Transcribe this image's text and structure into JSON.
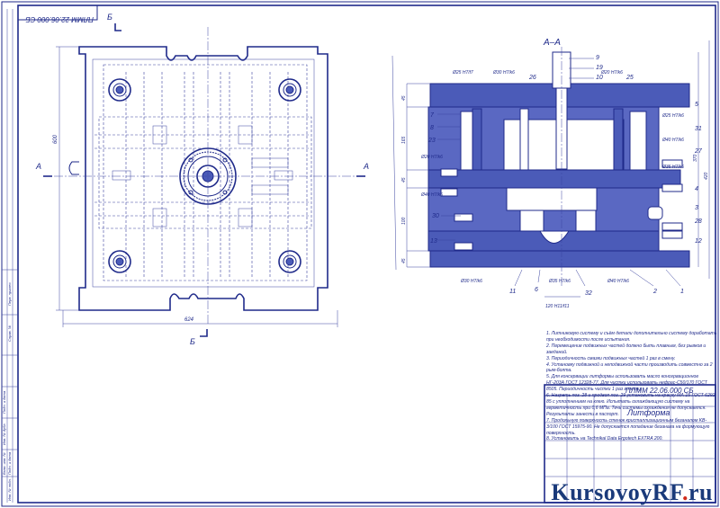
{
  "stamp_code_top": "ПЛММ 22.06.000 СБ",
  "stamp_code_bottom": "ПЛММ 22.06.000 СБ",
  "title_block_name": "Литформа",
  "section_label": "А–А",
  "cut_marks": {
    "a_left": "А",
    "a_right": "А",
    "b_top": "Б",
    "b_bottom": "Б"
  },
  "plan_dims": {
    "height": "600",
    "width": "624"
  },
  "section_dims_left": [
    "45",
    "165",
    "45",
    "100",
    "45"
  ],
  "section_dims_right": [
    "370",
    "420"
  ],
  "fits": [
    "Ø25 H7/f7",
    "Ø30 H7/k6",
    "Ø20 H7/k6",
    "Ø25 H7/k6",
    "Ø40 H7/k6",
    "Ø20 H7/k6",
    "Ø35 H7/k6",
    "Ø40 H7/k6",
    "Ø30 H7/k6",
    "Ø35 H7/k6",
    "Ø40 H7/k6",
    "120 H11/f11"
  ],
  "callouts": [
    "9",
    "19",
    "10",
    "26",
    "25",
    "5",
    "7",
    "8",
    "23",
    "31",
    "27",
    "4",
    "3",
    "28",
    "30",
    "12",
    "13",
    "2",
    "1",
    "11",
    "6",
    "32"
  ],
  "notes": [
    "1. Литниковую систему и съём детали дополнительно систему доработать при необходимости после испытания.",
    "2. Перемещение подвижных частей должно быть плавным, без рывков и заеданий.",
    "3. Периодичность смазки подвижных частей 1 раз в смену.",
    "4. Установку подвижной и неподвижной части производить совместно за 2 рым-болта.",
    "5. Для консервации литформы использовать масло консервационное НГ-203А ГОСТ 12328-77. Для чистки использовать нефрас-С50/170 ГОСТ 8505. Периодичность чистки 1 раз в месяц.",
    "6. Нагреть поз. 28 и продвоп поз. 29 установить на краску МА-15 ГОСТ 6292-85 с уплотнением на клею. Испытать охлаждающую систему на герметичность при 0,6 МПа. Течь системы охлаждения не допускается. Результаты занести в паспорт.",
    "7. Продольную поверхность стенок кристаллизационным безаналом KB-3/100 ГОСТ 15975-90. Не допускается попадание безанала на формующую поверхность.",
    "8. Установить на Technikal Data Ergotech EXTRA 200."
  ],
  "watermark": {
    "brand": "KursovoyRF",
    "tld": "ru"
  },
  "side_labels": [
    "Перв. примен.",
    "Справ. №",
    "Подп. и дата",
    "Инв. № дубл.",
    "Взам. инв. №",
    "Подп. и дата",
    "Инв. № подл."
  ]
}
